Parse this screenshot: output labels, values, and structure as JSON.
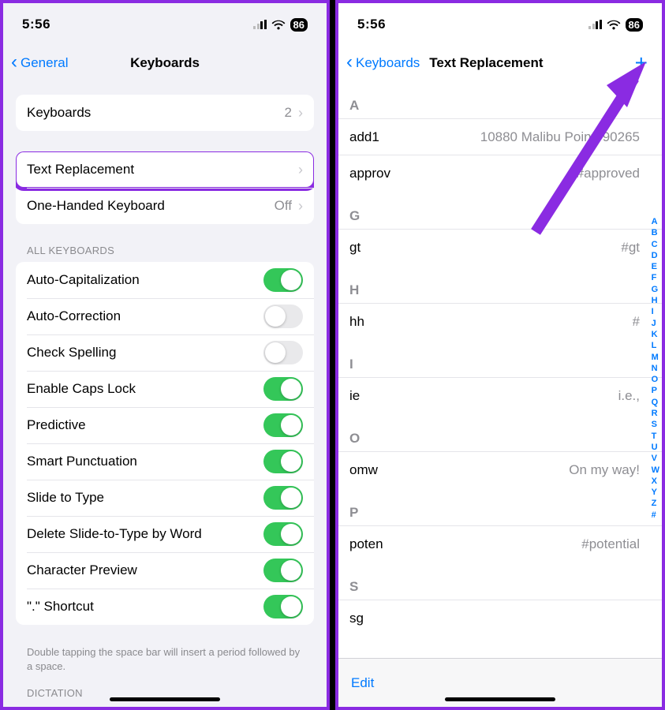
{
  "status": {
    "time": "5:56",
    "battery": "86"
  },
  "left": {
    "back": "General",
    "title": "Keyboards",
    "group1": [
      {
        "label": "Keyboards",
        "value": "2"
      }
    ],
    "group2": [
      {
        "label": "Text Replacement",
        "value": ""
      },
      {
        "label": "One-Handed Keyboard",
        "value": "Off"
      }
    ],
    "allKbHeader": "ALL KEYBOARDS",
    "toggles": [
      {
        "label": "Auto-Capitalization",
        "on": true
      },
      {
        "label": "Auto-Correction",
        "on": false
      },
      {
        "label": "Check Spelling",
        "on": false
      },
      {
        "label": "Enable Caps Lock",
        "on": true
      },
      {
        "label": "Predictive",
        "on": true
      },
      {
        "label": "Smart Punctuation",
        "on": true
      },
      {
        "label": "Slide to Type",
        "on": true
      },
      {
        "label": "Delete Slide-to-Type by Word",
        "on": true
      },
      {
        "label": "Character Preview",
        "on": true
      },
      {
        "label": "\".\" Shortcut",
        "on": true
      }
    ],
    "footnote": "Double tapping the space bar will insert a period followed by a space.",
    "dictationHeader": "DICTATION"
  },
  "right": {
    "back": "Keyboards",
    "title": "Text Replacement",
    "sections": [
      {
        "letter": "A",
        "items": [
          {
            "shortcut": "add1",
            "phrase": "10880 Malibu Point, 90265"
          },
          {
            "shortcut": "approv",
            "phrase": "#approved"
          }
        ]
      },
      {
        "letter": "G",
        "items": [
          {
            "shortcut": "gt",
            "phrase": "#gt"
          }
        ]
      },
      {
        "letter": "H",
        "items": [
          {
            "shortcut": "hh",
            "phrase": "#"
          }
        ]
      },
      {
        "letter": "I",
        "items": [
          {
            "shortcut": "ie",
            "phrase": "i.e.,"
          }
        ]
      },
      {
        "letter": "O",
        "items": [
          {
            "shortcut": "omw",
            "phrase": "On my way!"
          }
        ]
      },
      {
        "letter": "P",
        "items": [
          {
            "shortcut": "poten",
            "phrase": "#potential"
          }
        ]
      },
      {
        "letter": "S",
        "items": [
          {
            "shortcut": "sg",
            "phrase": ""
          }
        ]
      }
    ],
    "edit": "Edit",
    "index": [
      "A",
      "B",
      "C",
      "D",
      "E",
      "F",
      "G",
      "H",
      "I",
      "J",
      "K",
      "L",
      "M",
      "N",
      "O",
      "P",
      "Q",
      "R",
      "S",
      "T",
      "U",
      "V",
      "W",
      "X",
      "Y",
      "Z",
      "#"
    ]
  }
}
